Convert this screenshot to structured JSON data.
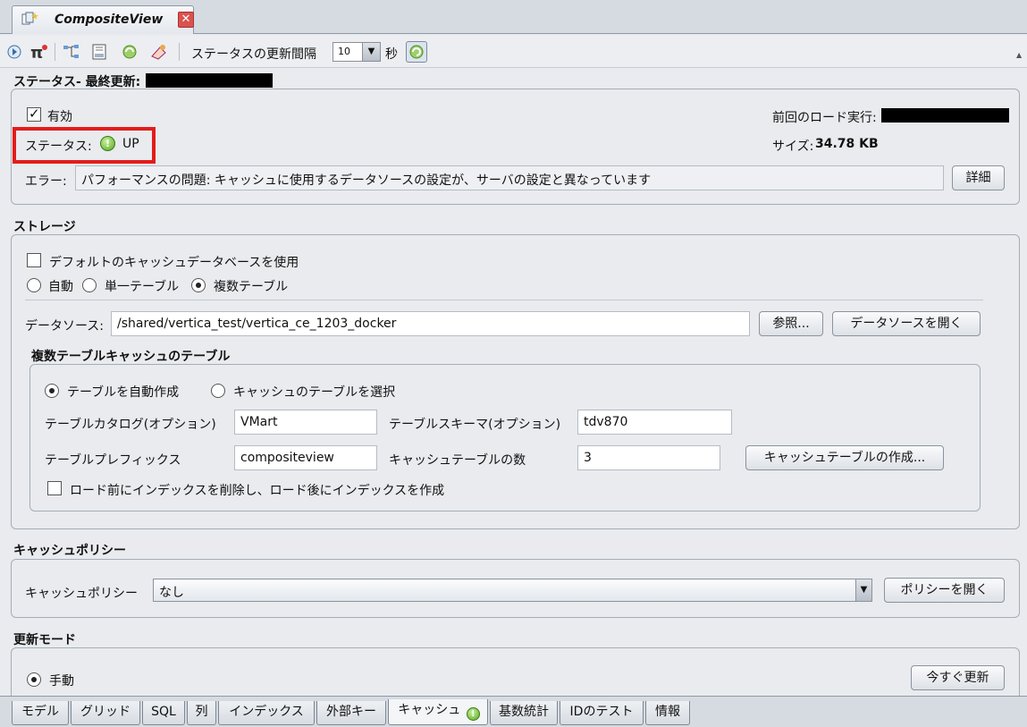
{
  "editor_tab": {
    "title": "CompositeView",
    "close": "✕"
  },
  "toolbar": {
    "refresh_interval_label": "ステータスの更新間隔",
    "interval_value": "10",
    "seconds_label": "秒"
  },
  "status": {
    "heading": "ステータス- 最終更新:",
    "enabled_label": "有効",
    "enabled": true,
    "status_label": "ステータス:",
    "status_value": "UP",
    "last_load_label": "前回のロード実行:",
    "size_label": "サイズ:",
    "size_value": "34.78 KB",
    "error_label": "エラー:",
    "error_value": "パフォーマンスの問題: キャッシュに使用するデータソースの設定が、サーバの設定と異なっています",
    "details_button": "詳細"
  },
  "storage": {
    "heading": "ストレージ",
    "use_default_db_label": "デフォルトのキャッシュデータベースを使用",
    "use_default_db": false,
    "mode_options": [
      "自動",
      "単一テーブル",
      "複数テーブル"
    ],
    "mode_selected": "複数テーブル",
    "datasource_label": "データソース:",
    "datasource_value": "/shared/vertica_test/vertica_ce_1203_docker",
    "browse_button": "参照...",
    "open_datasource_button": "データソースを開く",
    "multi_table": {
      "heading": "複数テーブルキャッシュのテーブル",
      "auto_create_label": "テーブルを自動作成",
      "select_tables_label": "キャッシュのテーブルを選択",
      "selected": "テーブルを自動作成",
      "catalog_label": "テーブルカタログ(オプション)",
      "catalog_value": "VMart",
      "schema_label": "テーブルスキーマ(オプション)",
      "schema_value": "tdv870",
      "prefix_label": "テーブルプレフィックス",
      "prefix_value": "compositeview",
      "count_label": "キャッシュテーブルの数",
      "count_value": "3",
      "create_button": "キャッシュテーブルの作成...",
      "drop_index_label": "ロード前にインデックスを削除し、ロード後にインデックスを作成",
      "drop_index": false
    }
  },
  "cache_policy": {
    "heading": "キャッシュポリシー",
    "label": "キャッシュポリシー",
    "value": "なし",
    "open_button": "ポリシーを開く"
  },
  "refresh_mode": {
    "heading": "更新モード",
    "manual_label": "手動",
    "manual": true,
    "refresh_now_button": "今すぐ更新"
  },
  "bottom_tabs": [
    "モデル",
    "グリッド",
    "SQL",
    "列",
    "インデックス",
    "外部キー",
    "キャッシュ",
    "基数統計",
    "IDのテスト",
    "情報"
  ],
  "active_tab": "キャッシュ"
}
